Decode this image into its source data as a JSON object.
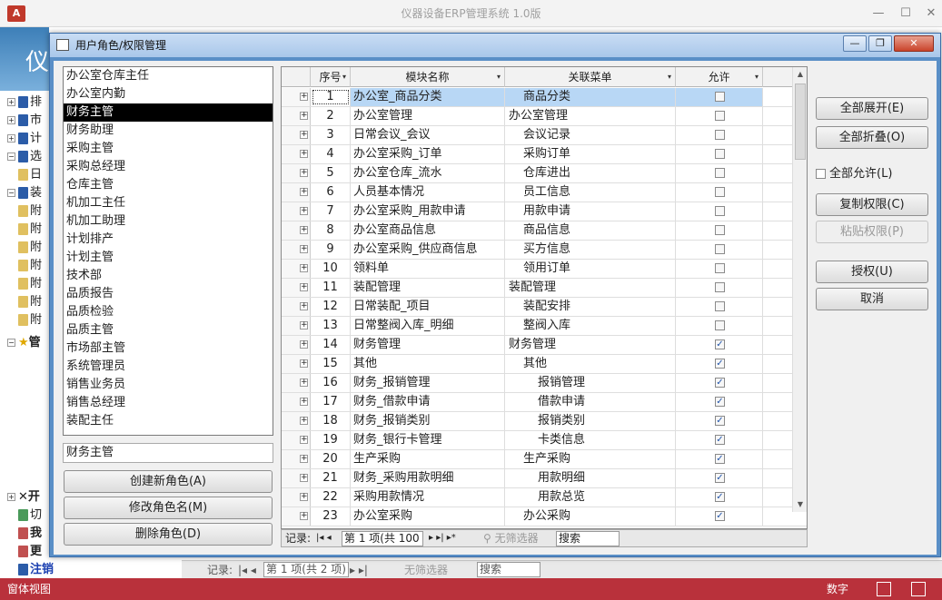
{
  "app": {
    "logo": "A",
    "title": "仪器设备ERP管理系统 1.0版",
    "banner_char": "仪"
  },
  "app_nav": [
    "排",
    "市",
    "计",
    "选",
    "日",
    "装",
    "附",
    "附",
    "附",
    "附",
    "附",
    "附",
    "附",
    "管"
  ],
  "app_nav_bottom": [
    "开",
    "切",
    "我",
    "更",
    "注销"
  ],
  "app_status": {
    "view": "窗体视图",
    "mode": "数字"
  },
  "bg_navbar": {
    "label": "记录:",
    "page": "第 1 项(共 2 项)",
    "filter": "无筛选器",
    "search": "搜索"
  },
  "dialog": {
    "title": "用户角色/权限管理",
    "roles": [
      "办公室仓库主任",
      "办公室内勤",
      "财务主管",
      "财务助理",
      "采购主管",
      "采购总经理",
      "仓库主管",
      "机加工主任",
      "机加工助理",
      "计划排产",
      "计划主管",
      "技术部",
      "品质报告",
      "品质检验",
      "品质主管",
      "市场部主管",
      "系统管理员",
      "销售业务员",
      "销售总经理",
      "装配主任"
    ],
    "selected_role": "财务主管",
    "role_name_value": "财务主管",
    "left_buttons": {
      "create": "创建新角色(A)",
      "rename": "修改角色名(M)",
      "delete": "删除角色(D)"
    },
    "grid": {
      "headers": {
        "seq": "序号",
        "module": "模块名称",
        "menu": "关联菜单",
        "allow": "允许"
      },
      "rows": [
        {
          "seq": "1",
          "module": "办公室_商品分类",
          "menu": "商品分类",
          "indent": 1,
          "allowed": false
        },
        {
          "seq": "2",
          "module": "办公室管理",
          "menu": "办公室管理",
          "indent": 0,
          "allowed": false
        },
        {
          "seq": "3",
          "module": "日常会议_会议",
          "menu": "会议记录",
          "indent": 1,
          "allowed": false
        },
        {
          "seq": "4",
          "module": "办公室采购_订单",
          "menu": "采购订单",
          "indent": 1,
          "allowed": false
        },
        {
          "seq": "5",
          "module": "办公室仓库_流水",
          "menu": "仓库进出",
          "indent": 1,
          "allowed": false
        },
        {
          "seq": "6",
          "module": "人员基本情况",
          "menu": "员工信息",
          "indent": 1,
          "allowed": false
        },
        {
          "seq": "7",
          "module": "办公室采购_用款申请",
          "menu": "用款申请",
          "indent": 1,
          "allowed": false
        },
        {
          "seq": "8",
          "module": "办公室商品信息",
          "menu": "商品信息",
          "indent": 1,
          "allowed": false
        },
        {
          "seq": "9",
          "module": "办公室采购_供应商信息",
          "menu": "买方信息",
          "indent": 1,
          "allowed": false
        },
        {
          "seq": "10",
          "module": "领料单",
          "menu": "领用订单",
          "indent": 1,
          "allowed": false
        },
        {
          "seq": "11",
          "module": "装配管理",
          "menu": "装配管理",
          "indent": 0,
          "allowed": false
        },
        {
          "seq": "12",
          "module": "日常装配_项目",
          "menu": "装配安排",
          "indent": 1,
          "allowed": false
        },
        {
          "seq": "13",
          "module": "日常整阀入库_明细",
          "menu": "整阀入库",
          "indent": 1,
          "allowed": false
        },
        {
          "seq": "14",
          "module": "财务管理",
          "menu": "财务管理",
          "indent": 0,
          "allowed": true
        },
        {
          "seq": "15",
          "module": "其他",
          "menu": "其他",
          "indent": 1,
          "allowed": true
        },
        {
          "seq": "16",
          "module": "财务_报销管理",
          "menu": "报销管理",
          "indent": 2,
          "allowed": true
        },
        {
          "seq": "17",
          "module": "财务_借款申请",
          "menu": "借款申请",
          "indent": 2,
          "allowed": true
        },
        {
          "seq": "18",
          "module": "财务_报销类别",
          "menu": "报销类别",
          "indent": 2,
          "allowed": true
        },
        {
          "seq": "19",
          "module": "财务_银行卡管理",
          "menu": "卡类信息",
          "indent": 2,
          "allowed": true
        },
        {
          "seq": "20",
          "module": "生产采购",
          "menu": "生产采购",
          "indent": 1,
          "allowed": true
        },
        {
          "seq": "21",
          "module": "财务_采购用款明细",
          "menu": "用款明细",
          "indent": 2,
          "allowed": true
        },
        {
          "seq": "22",
          "module": "采购用款情况",
          "menu": "用款总览",
          "indent": 2,
          "allowed": true
        },
        {
          "seq": "23",
          "module": "办公室采购",
          "menu": "办公采购",
          "indent": 1,
          "allowed": true
        }
      ],
      "navbar": {
        "label": "记录:",
        "page": "第 1 项(共 100 项)",
        "filter": "无筛选器",
        "search": "搜索"
      }
    },
    "right_buttons": {
      "expand": "全部展开(E)",
      "collapse": "全部折叠(O)",
      "allow_all": "全部允许(L)",
      "copy": "复制权限(C)",
      "paste": "粘贴权限(P)",
      "grant": "授权(U)",
      "cancel": "取消"
    }
  }
}
